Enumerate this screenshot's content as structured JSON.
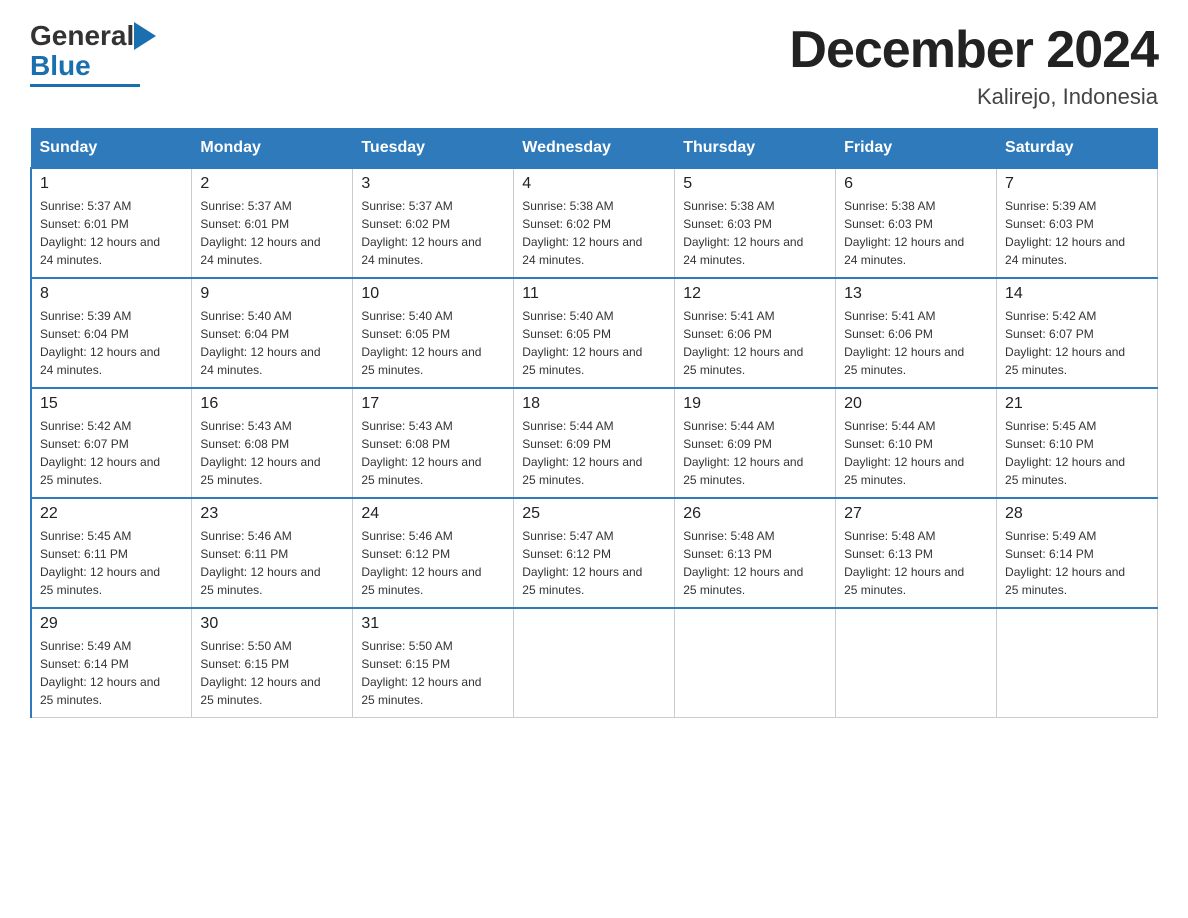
{
  "logo": {
    "general": "General",
    "blue": "Blue"
  },
  "title": "December 2024",
  "subtitle": "Kalirejo, Indonesia",
  "header_color": "#2e7abb",
  "days_of_week": [
    "Sunday",
    "Monday",
    "Tuesday",
    "Wednesday",
    "Thursday",
    "Friday",
    "Saturday"
  ],
  "weeks": [
    [
      {
        "day": "1",
        "sunrise": "Sunrise: 5:37 AM",
        "sunset": "Sunset: 6:01 PM",
        "daylight": "Daylight: 12 hours and 24 minutes."
      },
      {
        "day": "2",
        "sunrise": "Sunrise: 5:37 AM",
        "sunset": "Sunset: 6:01 PM",
        "daylight": "Daylight: 12 hours and 24 minutes."
      },
      {
        "day": "3",
        "sunrise": "Sunrise: 5:37 AM",
        "sunset": "Sunset: 6:02 PM",
        "daylight": "Daylight: 12 hours and 24 minutes."
      },
      {
        "day": "4",
        "sunrise": "Sunrise: 5:38 AM",
        "sunset": "Sunset: 6:02 PM",
        "daylight": "Daylight: 12 hours and 24 minutes."
      },
      {
        "day": "5",
        "sunrise": "Sunrise: 5:38 AM",
        "sunset": "Sunset: 6:03 PM",
        "daylight": "Daylight: 12 hours and 24 minutes."
      },
      {
        "day": "6",
        "sunrise": "Sunrise: 5:38 AM",
        "sunset": "Sunset: 6:03 PM",
        "daylight": "Daylight: 12 hours and 24 minutes."
      },
      {
        "day": "7",
        "sunrise": "Sunrise: 5:39 AM",
        "sunset": "Sunset: 6:03 PM",
        "daylight": "Daylight: 12 hours and 24 minutes."
      }
    ],
    [
      {
        "day": "8",
        "sunrise": "Sunrise: 5:39 AM",
        "sunset": "Sunset: 6:04 PM",
        "daylight": "Daylight: 12 hours and 24 minutes."
      },
      {
        "day": "9",
        "sunrise": "Sunrise: 5:40 AM",
        "sunset": "Sunset: 6:04 PM",
        "daylight": "Daylight: 12 hours and 24 minutes."
      },
      {
        "day": "10",
        "sunrise": "Sunrise: 5:40 AM",
        "sunset": "Sunset: 6:05 PM",
        "daylight": "Daylight: 12 hours and 25 minutes."
      },
      {
        "day": "11",
        "sunrise": "Sunrise: 5:40 AM",
        "sunset": "Sunset: 6:05 PM",
        "daylight": "Daylight: 12 hours and 25 minutes."
      },
      {
        "day": "12",
        "sunrise": "Sunrise: 5:41 AM",
        "sunset": "Sunset: 6:06 PM",
        "daylight": "Daylight: 12 hours and 25 minutes."
      },
      {
        "day": "13",
        "sunrise": "Sunrise: 5:41 AM",
        "sunset": "Sunset: 6:06 PM",
        "daylight": "Daylight: 12 hours and 25 minutes."
      },
      {
        "day": "14",
        "sunrise": "Sunrise: 5:42 AM",
        "sunset": "Sunset: 6:07 PM",
        "daylight": "Daylight: 12 hours and 25 minutes."
      }
    ],
    [
      {
        "day": "15",
        "sunrise": "Sunrise: 5:42 AM",
        "sunset": "Sunset: 6:07 PM",
        "daylight": "Daylight: 12 hours and 25 minutes."
      },
      {
        "day": "16",
        "sunrise": "Sunrise: 5:43 AM",
        "sunset": "Sunset: 6:08 PM",
        "daylight": "Daylight: 12 hours and 25 minutes."
      },
      {
        "day": "17",
        "sunrise": "Sunrise: 5:43 AM",
        "sunset": "Sunset: 6:08 PM",
        "daylight": "Daylight: 12 hours and 25 minutes."
      },
      {
        "day": "18",
        "sunrise": "Sunrise: 5:44 AM",
        "sunset": "Sunset: 6:09 PM",
        "daylight": "Daylight: 12 hours and 25 minutes."
      },
      {
        "day": "19",
        "sunrise": "Sunrise: 5:44 AM",
        "sunset": "Sunset: 6:09 PM",
        "daylight": "Daylight: 12 hours and 25 minutes."
      },
      {
        "day": "20",
        "sunrise": "Sunrise: 5:44 AM",
        "sunset": "Sunset: 6:10 PM",
        "daylight": "Daylight: 12 hours and 25 minutes."
      },
      {
        "day": "21",
        "sunrise": "Sunrise: 5:45 AM",
        "sunset": "Sunset: 6:10 PM",
        "daylight": "Daylight: 12 hours and 25 minutes."
      }
    ],
    [
      {
        "day": "22",
        "sunrise": "Sunrise: 5:45 AM",
        "sunset": "Sunset: 6:11 PM",
        "daylight": "Daylight: 12 hours and 25 minutes."
      },
      {
        "day": "23",
        "sunrise": "Sunrise: 5:46 AM",
        "sunset": "Sunset: 6:11 PM",
        "daylight": "Daylight: 12 hours and 25 minutes."
      },
      {
        "day": "24",
        "sunrise": "Sunrise: 5:46 AM",
        "sunset": "Sunset: 6:12 PM",
        "daylight": "Daylight: 12 hours and 25 minutes."
      },
      {
        "day": "25",
        "sunrise": "Sunrise: 5:47 AM",
        "sunset": "Sunset: 6:12 PM",
        "daylight": "Daylight: 12 hours and 25 minutes."
      },
      {
        "day": "26",
        "sunrise": "Sunrise: 5:48 AM",
        "sunset": "Sunset: 6:13 PM",
        "daylight": "Daylight: 12 hours and 25 minutes."
      },
      {
        "day": "27",
        "sunrise": "Sunrise: 5:48 AM",
        "sunset": "Sunset: 6:13 PM",
        "daylight": "Daylight: 12 hours and 25 minutes."
      },
      {
        "day": "28",
        "sunrise": "Sunrise: 5:49 AM",
        "sunset": "Sunset: 6:14 PM",
        "daylight": "Daylight: 12 hours and 25 minutes."
      }
    ],
    [
      {
        "day": "29",
        "sunrise": "Sunrise: 5:49 AM",
        "sunset": "Sunset: 6:14 PM",
        "daylight": "Daylight: 12 hours and 25 minutes."
      },
      {
        "day": "30",
        "sunrise": "Sunrise: 5:50 AM",
        "sunset": "Sunset: 6:15 PM",
        "daylight": "Daylight: 12 hours and 25 minutes."
      },
      {
        "day": "31",
        "sunrise": "Sunrise: 5:50 AM",
        "sunset": "Sunset: 6:15 PM",
        "daylight": "Daylight: 12 hours and 25 minutes."
      },
      null,
      null,
      null,
      null
    ]
  ]
}
